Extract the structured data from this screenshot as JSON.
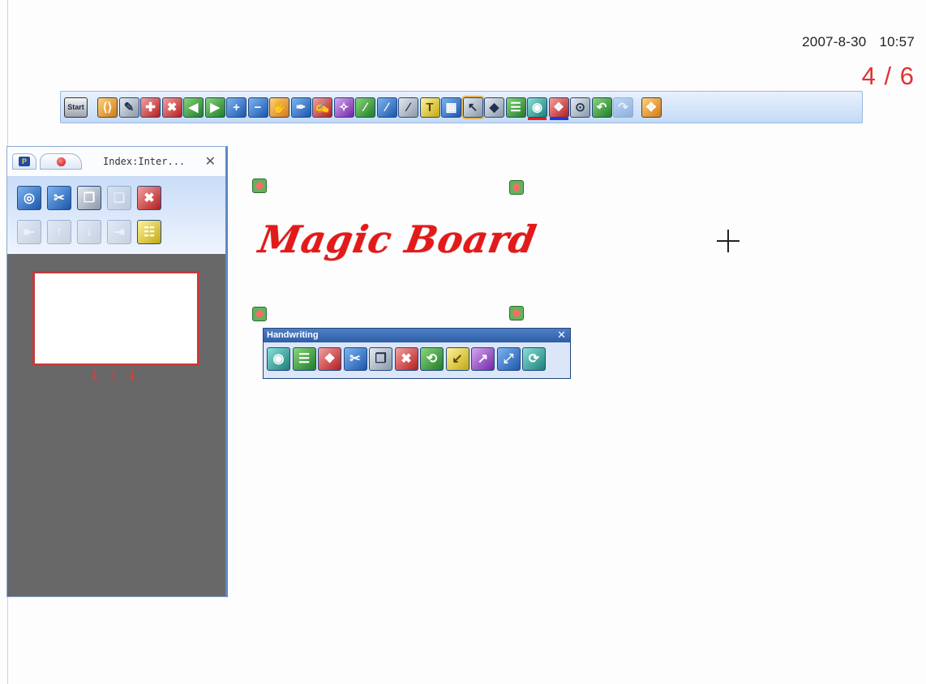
{
  "header": {
    "date": "2007-8-30",
    "time": "10:57",
    "page_counter": "4 / 6"
  },
  "main_toolbar": {
    "start_label": "Start",
    "buttons": [
      {
        "name": "brackets-icon",
        "glyph": "⟨⟩",
        "color": "orange"
      },
      {
        "name": "sketch-icon",
        "glyph": "✎",
        "color": "gray"
      },
      {
        "name": "new-page-icon",
        "glyph": "✚",
        "color": "red"
      },
      {
        "name": "delete-page-icon",
        "glyph": "✖",
        "color": "red"
      },
      {
        "name": "previous-page-icon",
        "glyph": "◀",
        "color": "green"
      },
      {
        "name": "next-page-icon",
        "glyph": "▶",
        "color": "green"
      },
      {
        "name": "zoom-in-icon",
        "glyph": "+",
        "color": "blue"
      },
      {
        "name": "zoom-out-icon",
        "glyph": "−",
        "color": "blue"
      },
      {
        "name": "hand-pan-icon",
        "glyph": "✋",
        "color": "orange"
      },
      {
        "name": "pen-icon",
        "glyph": "✒",
        "color": "blue"
      },
      {
        "name": "brush-icon",
        "glyph": "✍",
        "color": "red"
      },
      {
        "name": "magic-pen-icon",
        "glyph": "✧",
        "color": "purple"
      },
      {
        "name": "highlighter-icon",
        "glyph": "∕",
        "color": "green"
      },
      {
        "name": "marker-icon",
        "glyph": "∕",
        "color": "blue"
      },
      {
        "name": "soft-pen-icon",
        "glyph": "∕",
        "color": "gray"
      },
      {
        "name": "text-icon",
        "glyph": "T",
        "color": "yellow"
      },
      {
        "name": "film-icon",
        "glyph": "▦",
        "color": "blue"
      },
      {
        "name": "select-arrow-icon",
        "glyph": "↖",
        "color": "gray",
        "active": true
      },
      {
        "name": "eraser-icon",
        "glyph": "◆",
        "color": "gray"
      },
      {
        "name": "line-width-icon",
        "glyph": "☰",
        "color": "green"
      },
      {
        "name": "pen-color-icon",
        "glyph": "◉",
        "color": "teal",
        "underline": "red"
      },
      {
        "name": "background-color-icon",
        "glyph": "❖",
        "color": "red",
        "underline": "blue"
      },
      {
        "name": "capture-icon",
        "glyph": "⊙",
        "color": "gray"
      },
      {
        "name": "undo-icon",
        "glyph": "↶",
        "color": "green"
      },
      {
        "name": "redo-icon",
        "glyph": "↷",
        "color": "blue",
        "faded": true
      },
      {
        "name": "move-toolbar-icon",
        "glyph": "✥",
        "color": "orange",
        "gap": true
      }
    ]
  },
  "side_panel": {
    "title": "Index:Inter...",
    "close_glyph": "✕",
    "tabs": [
      "powerpoint-tab",
      "pen-tab"
    ],
    "row1": [
      {
        "name": "globe-icon",
        "glyph": "◎",
        "color": "blue"
      },
      {
        "name": "cut-icon",
        "glyph": "✂",
        "color": "blue"
      },
      {
        "name": "copy-icon",
        "glyph": "❐",
        "color": "gray"
      },
      {
        "name": "paste-icon",
        "glyph": "❏",
        "color": "gray",
        "faded": true
      },
      {
        "name": "delete-icon",
        "glyph": "✖",
        "color": "red"
      }
    ],
    "row2": [
      {
        "name": "move-first-icon",
        "glyph": "⇤",
        "color": "gray",
        "faded": true
      },
      {
        "name": "move-up-icon",
        "glyph": "↑",
        "color": "gray",
        "faded": true
      },
      {
        "name": "move-down-icon",
        "glyph": "↓",
        "color": "gray",
        "faded": true
      },
      {
        "name": "move-last-icon",
        "glyph": "⇥",
        "color": "gray",
        "faded": true
      },
      {
        "name": "index-list-icon",
        "glyph": "☷",
        "color": "yellow"
      }
    ],
    "slide_caption": "1 / 1"
  },
  "canvas": {
    "title_text": "Magic Board"
  },
  "handwriting_palette": {
    "title": "Handwriting",
    "close_glyph": "✕",
    "buttons": [
      {
        "name": "hw-color-icon",
        "glyph": "◉",
        "color": "teal"
      },
      {
        "name": "hw-line-width-icon",
        "glyph": "☰",
        "color": "green"
      },
      {
        "name": "hw-background-icon",
        "glyph": "❖",
        "color": "red"
      },
      {
        "name": "hw-cut-icon",
        "glyph": "✂",
        "color": "blue"
      },
      {
        "name": "hw-copy-icon",
        "glyph": "❐",
        "color": "gray"
      },
      {
        "name": "hw-delete-icon",
        "glyph": "✖",
        "color": "red"
      },
      {
        "name": "hw-rotate-icon",
        "glyph": "⟲",
        "color": "green"
      },
      {
        "name": "hw-bring-forward-icon",
        "glyph": "↙",
        "color": "yellow"
      },
      {
        "name": "hw-send-backward-icon",
        "glyph": "↗",
        "color": "purple"
      },
      {
        "name": "hw-align-icon",
        "glyph": "⤢",
        "color": "blue"
      },
      {
        "name": "hw-group-icon",
        "glyph": "⟳",
        "color": "teal"
      }
    ]
  }
}
